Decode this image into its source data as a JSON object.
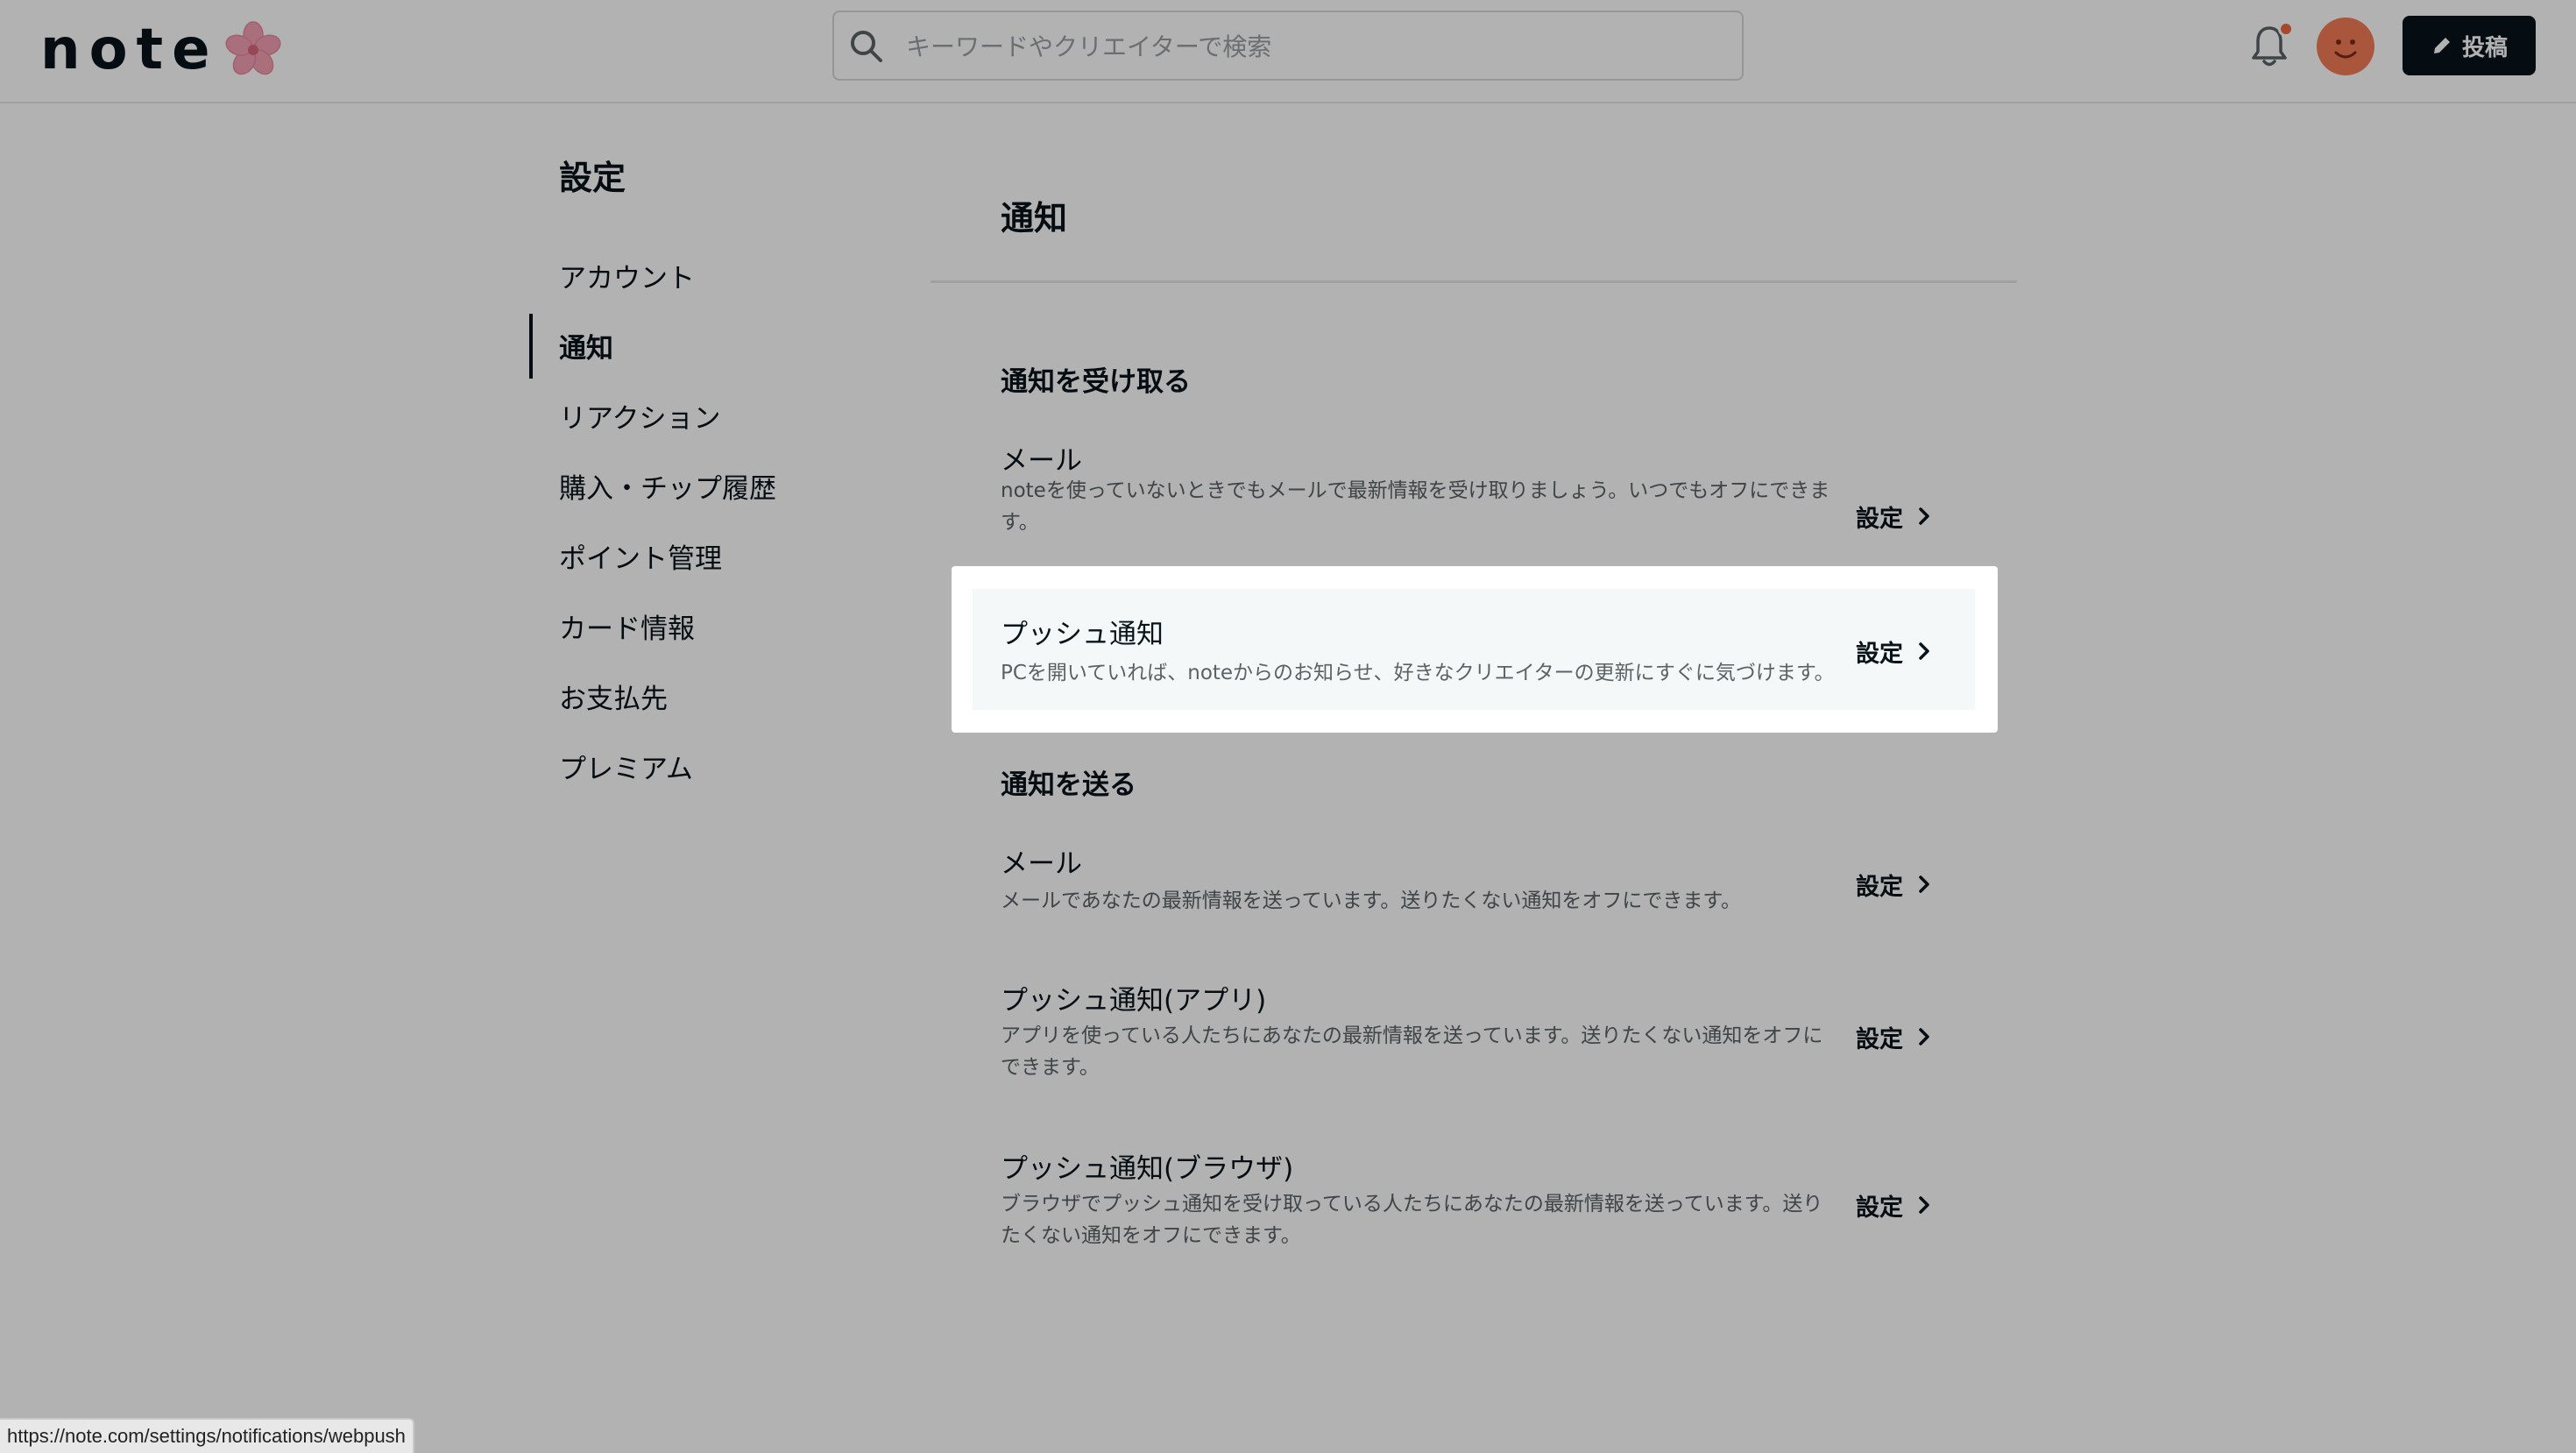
{
  "header": {
    "logo_text": "note",
    "search_placeholder": "キーワードやクリエイターで検索",
    "post_label": "投稿"
  },
  "sidebar": {
    "title": "設定",
    "items": [
      {
        "label": "アカウント"
      },
      {
        "label": "通知"
      },
      {
        "label": "リアクション"
      },
      {
        "label": "購入・チップ履歴"
      },
      {
        "label": "ポイント管理"
      },
      {
        "label": "カード情報"
      },
      {
        "label": "お支払先"
      },
      {
        "label": "プレミアム"
      }
    ],
    "active": "通知"
  },
  "main": {
    "title": "通知",
    "receive": {
      "title": "通知を受け取る",
      "rows": [
        {
          "title": "メール",
          "desc": "noteを使っていないときでもメールで最新情報を受け取りましょう。いつでもオフにできます。",
          "link": "設定"
        },
        {
          "title": "プッシュ通知",
          "desc": "PCを開いていれば、noteからのお知らせ、好きなクリエイターの更新にすぐに気づけます。",
          "link": "設定"
        }
      ]
    },
    "send": {
      "title": "通知を送る",
      "rows": [
        {
          "title": "メール",
          "desc": "メールであなたの最新情報を送っています。送りたくない通知をオフにできます。",
          "link": "設定"
        },
        {
          "title": "プッシュ通知(アプリ)",
          "desc": "アプリを使っている人たちにあなたの最新情報を送っています。送りたくない通知をオフにできます。",
          "link": "設定"
        },
        {
          "title": "プッシュ通知(ブラウザ)",
          "desc": "ブラウザでプッシュ通知を受け取っている人たちにあなたの最新情報を送っています。送りたくない通知をオフにできます。",
          "link": "設定"
        }
      ]
    }
  },
  "status_bar": {
    "url": "https://note.com/settings/notifications/webpush"
  },
  "colors": {
    "accent": "#08131a",
    "avatar": "#f47b57",
    "badge": "#ee6840",
    "highlight_bg": "#f5f8f8"
  }
}
